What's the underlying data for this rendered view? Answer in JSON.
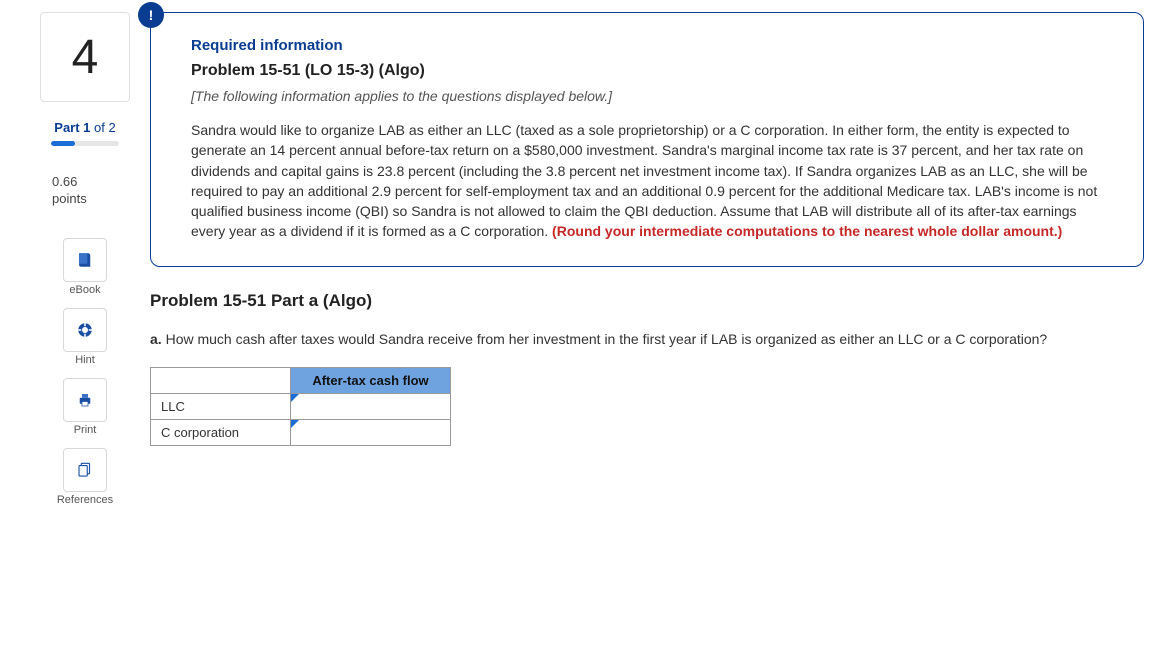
{
  "sidebar": {
    "question_number": "4",
    "part_bold": "Part 1",
    "part_rest": " of 2",
    "progress_pct": 35,
    "points_value": "0.66",
    "points_label": "points",
    "tools": {
      "ebook": "eBook",
      "hint": "Hint",
      "print": "Print",
      "references": "References"
    }
  },
  "info_box": {
    "badge": "!",
    "required_label": "Required information",
    "title": "Problem 15-51 (LO 15-3) (Algo)",
    "applies_note": "[The following information applies to the questions displayed below.]",
    "body": "Sandra would like to organize LAB as either an LLC (taxed as a sole proprietorship) or a C corporation. In either form, the entity is expected to generate an 14 percent annual before-tax return on a $580,000 investment. Sandra's marginal income tax rate is 37 percent, and her tax rate on dividends and capital gains is 23.8 percent (including the 3.8 percent net investment income tax). If Sandra organizes LAB as an LLC, she will be required to pay an additional 2.9 percent for self-employment tax and an additional 0.9 percent for the additional Medicare tax. LAB's income is not qualified business income (QBI) so Sandra is not allowed to claim the QBI deduction. Assume that LAB will distribute all of its after-tax earnings every year as a dividend if it is formed as a C corporation.",
    "round_note": " (Round your intermediate computations to the nearest whole dollar amount.)"
  },
  "question": {
    "part_title": "Problem 15-51 Part a (Algo)",
    "prefix": "a.",
    "text": " How much cash after taxes would Sandra receive from her investment in the first year if LAB is organized as either an LLC or a C corporation?",
    "table": {
      "header": "After-tax cash flow",
      "rows": [
        "LLC",
        "C corporation"
      ],
      "values": [
        "",
        ""
      ]
    }
  }
}
